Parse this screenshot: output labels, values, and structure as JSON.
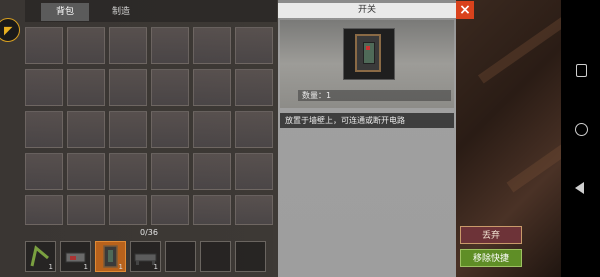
{
  "tabs": {
    "backpack": "背包",
    "craft": "制造"
  },
  "inventory": {
    "count": "0/36"
  },
  "hotbar": [
    {
      "icon": "rod-icon",
      "qty": "1"
    },
    {
      "icon": "device-icon",
      "qty": "1"
    },
    {
      "icon": "switch-icon",
      "qty": "1",
      "selected": true
    },
    {
      "icon": "bed-icon",
      "qty": "1"
    },
    {
      "icon": "",
      "qty": ""
    },
    {
      "icon": "",
      "qty": ""
    },
    {
      "icon": "",
      "qty": ""
    }
  ],
  "detail": {
    "title": "开关",
    "quantity": "数量：1",
    "description": "放置于墙壁上，可连通或断开电路",
    "close_symbol": "×"
  },
  "actions": {
    "discard": "丢弃",
    "remove_shortcut": "移除快捷"
  },
  "colors": {
    "selected_slot": "#b8621c",
    "discard": "#6d3338",
    "remove": "#5f8e26",
    "close": "#d9421c"
  }
}
